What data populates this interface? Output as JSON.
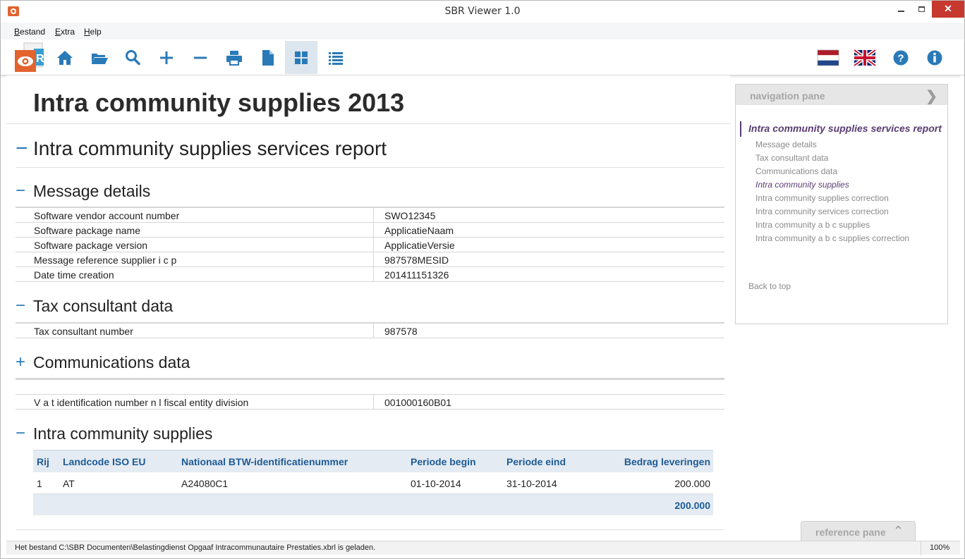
{
  "window": {
    "title": "SBR Viewer 1.0"
  },
  "menu": [
    {
      "label": "Bestand",
      "accel": "B",
      "rest": "estand"
    },
    {
      "label": "Extra",
      "accel": "E",
      "rest": "xtra"
    },
    {
      "label": "Help",
      "accel": "H",
      "rest": "elp"
    }
  ],
  "toolbar": {
    "buttons": [
      "home-icon",
      "open-folder-icon",
      "search-icon",
      "plus-icon",
      "minus-icon",
      "print-icon",
      "document-icon",
      "grid-view-icon",
      "list-view-icon"
    ],
    "active": "grid-view-icon",
    "right": [
      "flag-nl-icon",
      "flag-uk-icon",
      "help-icon",
      "info-icon"
    ]
  },
  "colors": {
    "accent": "#2a7ab8",
    "nav_active": "#5a3d73",
    "header_bg": "#e4ebf2"
  },
  "document": {
    "title": "Intra community supplies 2013",
    "report": {
      "toggle": "−",
      "title": "Intra community supplies services report"
    },
    "sections": {
      "message": {
        "toggle": "−",
        "title": "Message details",
        "rows": [
          {
            "k": "Software vendor account number",
            "v": "SWO12345"
          },
          {
            "k": "Software package name",
            "v": "ApplicatieNaam"
          },
          {
            "k": "Software package version",
            "v": "ApplicatieVersie"
          },
          {
            "k": "Message reference supplier i c p",
            "v": "987578MESID"
          },
          {
            "k": "Date time creation",
            "v": "201411151326"
          }
        ]
      },
      "tax": {
        "toggle": "−",
        "title": "Tax consultant data",
        "rows": [
          {
            "k": "Tax consultant number",
            "v": "987578"
          }
        ]
      },
      "comm": {
        "toggle": "+",
        "title": "Communications data",
        "rows": [
          {
            "k": "V a t identification number n l fiscal entity division",
            "v": "001000160B01"
          }
        ]
      },
      "supplies": {
        "toggle": "−",
        "title": "Intra community supplies",
        "headers": [
          "Rij",
          "Landcode ISO EU",
          "Nationaal BTW-identificatienummer",
          "Periode begin",
          "Periode eind",
          "Bedrag leveringen"
        ],
        "rows": [
          [
            "1",
            "AT",
            "A24080C1",
            "01-10-2014",
            "31-10-2014",
            "200.000"
          ]
        ],
        "total": "200.000"
      }
    }
  },
  "nav": {
    "header": "navigation pane",
    "main": "Intra community supplies services report",
    "items": [
      "Message details",
      "Tax consultant data",
      "Communications data",
      "Intra community supplies",
      "Intra community supplies correction",
      "Intra community services correction",
      "Intra community a b c supplies",
      "Intra community a b c supplies correction"
    ],
    "current_index": 3,
    "back": "Back to top"
  },
  "reference": {
    "header": "reference pane"
  },
  "status": {
    "text": "Het bestand C:\\SBR Documenten\\Belastingdienst Opgaaf Intracommunautaire Prestaties.xbrl is geladen.",
    "zoom": "100%"
  }
}
